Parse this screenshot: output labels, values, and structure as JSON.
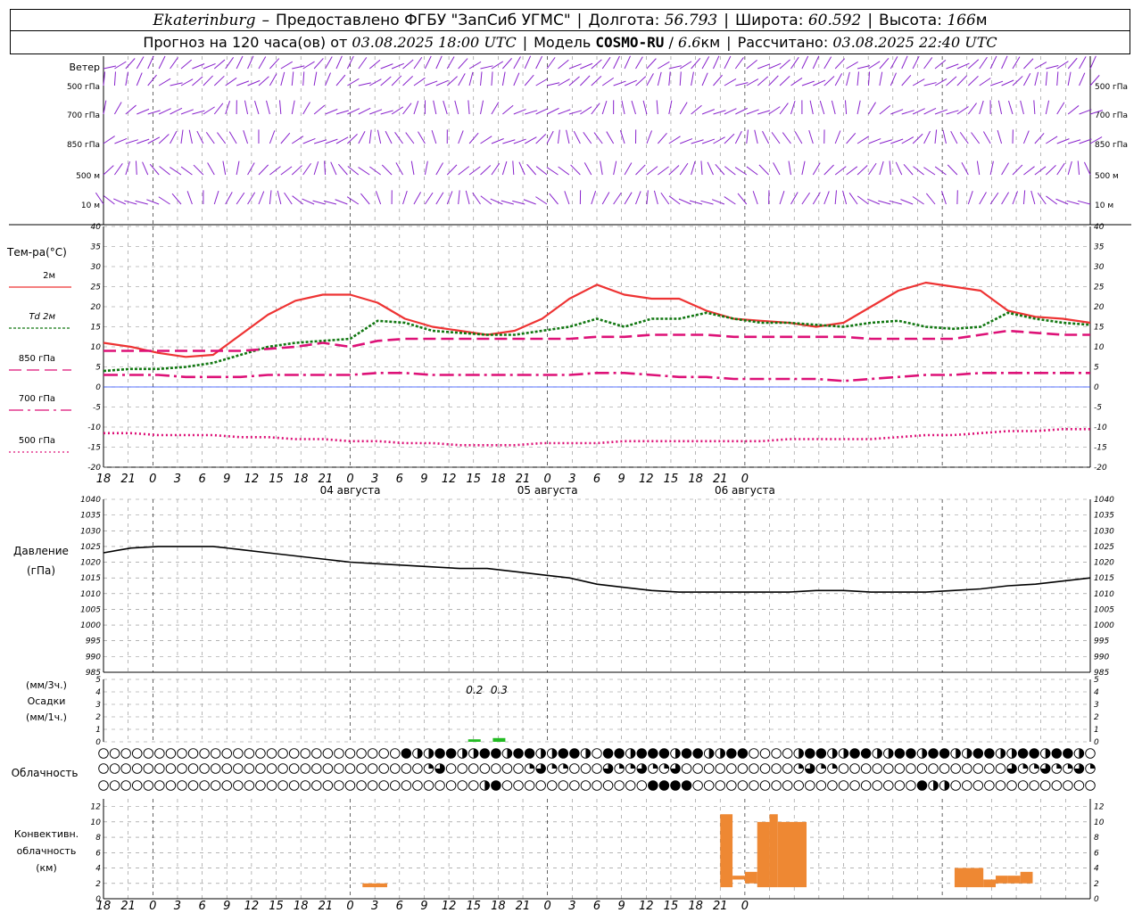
{
  "header": {
    "city": "Ekaterinburg",
    "dash": "–",
    "provider": "Предоставлено ФГБУ \"ЗапСиб УГМС\"",
    "lon_label": "Долгота:",
    "lon": "56.793",
    "lat_label": "Широта:",
    "lat": "60.592",
    "alt_label": "Высота:",
    "alt": "166",
    "alt_unit": "м",
    "forecast_label": "Прогноз на 120 часа(ов) от",
    "forecast_start": "03.08.2025 18:00 UTC",
    "model_label": "Модель",
    "model": "COSMO-RU",
    "model_res": "6.6",
    "model_res_unit": "км",
    "computed_label": "Рассчитано:",
    "computed": "03.08.2025 22:40 UTC"
  },
  "time_axis": {
    "hour_labels": [
      "18",
      "21",
      "0",
      "3",
      "6",
      "9",
      "12",
      "15",
      "18",
      "21",
      "0",
      "3",
      "6",
      "9",
      "12",
      "15",
      "18",
      "21",
      "0",
      "3",
      "6",
      "9",
      "12",
      "15",
      "18",
      "21",
      "0"
    ],
    "dates": [
      "04 августа",
      "05 августа",
      "06 августа"
    ]
  },
  "chart_data": [
    {
      "type": "wind_barbs",
      "title": "Ветер",
      "levels": [
        "500 гПа",
        "700 гПа",
        "850 гПа",
        "500 м",
        "10  м"
      ]
    },
    {
      "type": "line",
      "title": "Тем-ра(°C)",
      "x_hours": [
        0,
        3,
        6,
        9,
        12,
        15,
        18,
        21,
        24,
        27,
        30,
        33,
        36,
        39,
        42,
        45,
        48,
        51,
        54,
        57,
        60,
        63,
        66,
        69,
        72,
        75,
        78,
        81,
        84,
        87,
        90,
        93,
        96,
        99,
        102,
        105,
        108,
        111,
        114,
        117,
        120
      ],
      "ylim": [
        -20,
        40
      ],
      "yticks": [
        40,
        35,
        30,
        25,
        20,
        15,
        10,
        5,
        0,
        -5,
        -10,
        -15,
        -20
      ],
      "series": [
        {
          "name": "2м",
          "color": "#ee3333",
          "style": "solid",
          "values": [
            11,
            10,
            8.5,
            7.5,
            8,
            13,
            18,
            21.5,
            23,
            23,
            21,
            17,
            15,
            14,
            13,
            14,
            17,
            22,
            25.5,
            23,
            22,
            22,
            19,
            17,
            16.5,
            16,
            15,
            16,
            20,
            24,
            26,
            25,
            24,
            19,
            17.5,
            17,
            16
          ]
        },
        {
          "name": "Td  2м",
          "color": "#117711",
          "style": "dotted",
          "values": [
            4,
            4.5,
            4.5,
            5,
            6,
            8,
            10,
            11,
            11.5,
            12,
            16.5,
            16,
            14,
            13.5,
            13,
            13,
            14,
            15,
            17,
            15,
            17,
            17,
            18.5,
            17,
            16,
            16,
            15.5,
            15,
            16,
            16.5,
            15,
            14.5,
            15,
            18.5,
            17,
            16,
            15.5
          ]
        },
        {
          "name": "850 гПа",
          "color": "#dd1177",
          "style": "dash",
          "values": [
            9,
            9,
            9,
            9,
            9,
            9,
            9.5,
            10,
            11,
            10,
            11.5,
            12,
            12,
            12,
            12,
            12,
            12,
            12,
            12.5,
            12.5,
            13,
            13,
            13,
            12.5,
            12.5,
            12.5,
            12.5,
            12.5,
            12,
            12,
            12,
            12,
            13,
            14,
            13.5,
            13,
            13
          ]
        },
        {
          "name": "700 гПа",
          "color": "#dd1177",
          "style": "dashdot",
          "values": [
            3,
            3,
            3,
            2.5,
            2.5,
            2.5,
            3,
            3,
            3,
            3,
            3.5,
            3.5,
            3,
            3,
            3,
            3,
            3,
            3,
            3.5,
            3.5,
            3,
            2.5,
            2.5,
            2,
            2,
            2,
            2,
            1.5,
            2,
            2.5,
            3,
            3,
            3.5,
            3.5,
            3.5,
            3.5,
            3.5
          ]
        },
        {
          "name": "500 гПа",
          "color": "#dd1177",
          "style": "dot",
          "values": [
            -11.5,
            -11.5,
            -12,
            -12,
            -12,
            -12.5,
            -12.5,
            -13,
            -13,
            -13.5,
            -13.5,
            -14,
            -14,
            -14.5,
            -14.5,
            -14.5,
            -14,
            -14,
            -14,
            -13.5,
            -13.5,
            -13.5,
            -13.5,
            -13.5,
            -13.5,
            -13,
            -13,
            -13,
            -13,
            -12.5,
            -12,
            -12,
            -11.5,
            -11,
            -11,
            -10.5,
            -10.5
          ]
        }
      ]
    },
    {
      "type": "line",
      "title": "Давление",
      "unit": "(гПа)",
      "ylim": [
        985,
        1040
      ],
      "yticks": [
        1040,
        1035,
        1030,
        1025,
        1020,
        1015,
        1010,
        1005,
        1000,
        995,
        990,
        985
      ],
      "series": [
        {
          "name": "",
          "color": "#000000",
          "style": "solid",
          "values": [
            1023,
            1024.5,
            1025,
            1025,
            1025,
            1024,
            1023,
            1022,
            1021,
            1020,
            1019.5,
            1019,
            1018.5,
            1018,
            1018,
            1017,
            1016,
            1015,
            1013,
            1012,
            1011,
            1010.5,
            1010.5,
            1010.5,
            1010.5,
            1010.5,
            1011,
            1011,
            1010.5,
            1010.5,
            1010.5,
            1011,
            1011.5,
            1012.5,
            1013,
            1014,
            1015
          ]
        }
      ]
    },
    {
      "type": "bar",
      "title": "Осадки",
      "labels_left": [
        "(мм/3ч.)",
        "Осадки",
        "(мм/1ч.)"
      ],
      "ylim": [
        0,
        5
      ],
      "yticks": [
        5,
        4,
        3,
        2,
        1,
        0
      ],
      "bars": [
        {
          "hour": 45,
          "value": 0.2,
          "label": "0.2"
        },
        {
          "hour": 48,
          "value": 0.3,
          "label": "0.3"
        }
      ]
    },
    {
      "type": "cloud_symbols",
      "title": "Облачность",
      "rows": [
        "upper",
        "middle",
        "lower"
      ]
    },
    {
      "type": "bar",
      "title": "Конвективн. облачность (км)",
      "labels_left": [
        "Конвективн.",
        "облачность",
        "(км)"
      ],
      "ylim": [
        0,
        13
      ],
      "yticks": [
        12,
        10,
        8,
        6,
        4,
        2,
        0
      ],
      "bars": [
        {
          "hour_start": 31.5,
          "hour_end": 34.5,
          "base": 1.5,
          "top": 2
        },
        {
          "hour_start": 75,
          "hour_end": 76.5,
          "base": 1.5,
          "top": 11
        },
        {
          "hour_start": 76.5,
          "hour_end": 78,
          "base": 2.5,
          "top": 3
        },
        {
          "hour_start": 78,
          "hour_end": 79.5,
          "base": 2,
          "top": 3.5
        },
        {
          "hour_start": 79.5,
          "hour_end": 81,
          "base": 1.5,
          "top": 10
        },
        {
          "hour_start": 81,
          "hour_end": 82,
          "base": 1.5,
          "top": 11
        },
        {
          "hour_start": 82,
          "hour_end": 85.5,
          "base": 1.5,
          "top": 10
        },
        {
          "hour_start": 103.5,
          "hour_end": 107,
          "base": 1.5,
          "top": 4
        },
        {
          "hour_start": 107,
          "hour_end": 108.5,
          "base": 1.5,
          "top": 2.5
        },
        {
          "hour_start": 108.5,
          "hour_end": 110,
          "base": 2,
          "top": 3
        },
        {
          "hour_start": 110,
          "hour_end": 111.5,
          "base": 2,
          "top": 3
        },
        {
          "hour_start": 111.5,
          "hour_end": 113,
          "base": 2,
          "top": 3.5
        }
      ]
    }
  ],
  "colors": {
    "grid": "#888888",
    "wind": "#8822cc",
    "rain": "#22bb22",
    "convective": "#ee8833"
  }
}
